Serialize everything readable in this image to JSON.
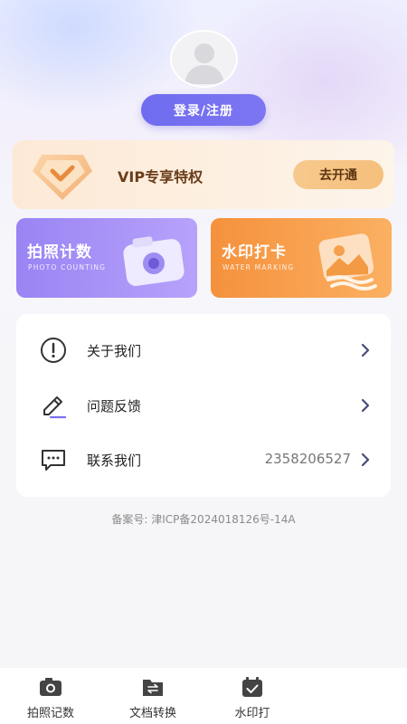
{
  "profile": {
    "login_label": "登录/注册"
  },
  "vip": {
    "title": "VIP专享特权",
    "button_label": "去开通"
  },
  "features": [
    {
      "title": "拍照计数",
      "subtitle": "PHOTO COUNTING"
    },
    {
      "title": "水印打卡",
      "subtitle": "WATER MARKING"
    }
  ],
  "menu": [
    {
      "label": "关于我们",
      "icon": "info-icon",
      "value": ""
    },
    {
      "label": "问题反馈",
      "icon": "edit-icon",
      "value": ""
    },
    {
      "label": "联系我们",
      "icon": "chat-icon",
      "value": "2358206527"
    }
  ],
  "icp": {
    "text": "备案号: 津ICP备2024018126号-14A"
  },
  "tabbar": [
    {
      "label": "拍照记数",
      "icon": "camera-icon"
    },
    {
      "label": "文档转换",
      "icon": "folder-convert-icon"
    },
    {
      "label": "水印打",
      "icon": "calendar-check-icon"
    }
  ],
  "colors": {
    "primary": "#6f6cf0",
    "vip_text": "#6b3d19",
    "photo_card": "#9a84f4",
    "water_card": "#f5913c",
    "arrow": "#4a4a7a"
  }
}
